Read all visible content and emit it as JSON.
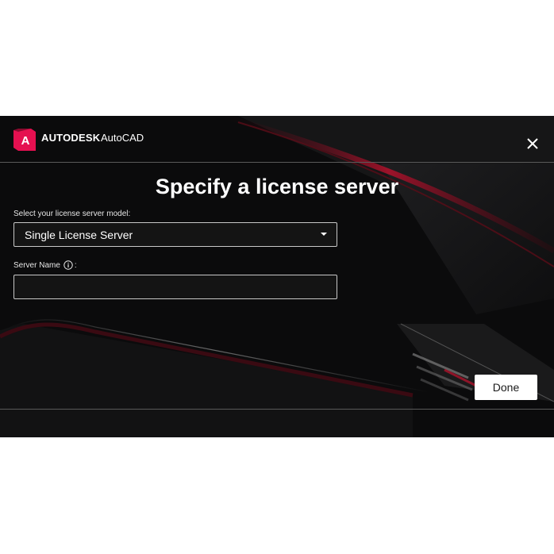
{
  "header": {
    "brand_letter": "A",
    "brand_name": "AUTODESK",
    "product_name": "AutoCAD",
    "close_icon": "close-icon"
  },
  "main": {
    "title": "Specify a license server",
    "model_label": "Select your license server model:",
    "model_select": {
      "selected": "Single License Server",
      "caret_icon": "caret-down-icon"
    },
    "server_name_label": "Server Name",
    "server_name_info_icon": "info-icon",
    "server_name_colon": ":",
    "server_name_value": ""
  },
  "footer": {
    "done_label": "Done"
  },
  "colors": {
    "background": "#0b0b0c",
    "accent_red": "#e51050",
    "text": "#ffffff",
    "button_bg": "#ffffff"
  }
}
